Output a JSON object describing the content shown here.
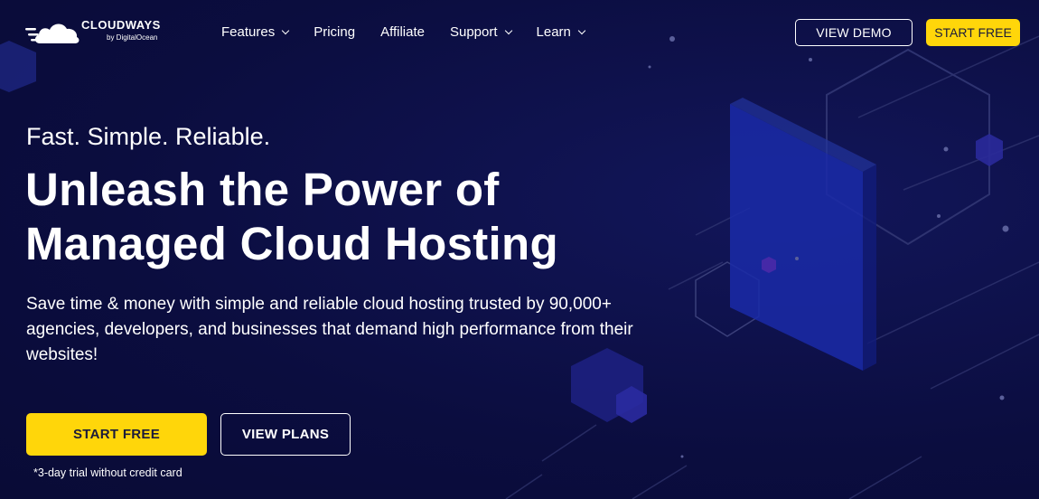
{
  "header": {
    "logo": {
      "name": "CLOUDWAYS",
      "sub": "by DigitalOcean",
      "icon": "cloud-logo-icon"
    },
    "nav": [
      {
        "label": "Features",
        "has_dropdown": true
      },
      {
        "label": "Pricing",
        "has_dropdown": false
      },
      {
        "label": "Affiliate",
        "has_dropdown": false
      },
      {
        "label": "Support",
        "has_dropdown": true
      },
      {
        "label": "Learn",
        "has_dropdown": true
      }
    ],
    "view_demo_label": "VIEW DEMO",
    "start_free_label": "START FREE"
  },
  "hero": {
    "eyebrow": "Fast. Simple. Reliable.",
    "headline_line1": "Unleash the Power of",
    "headline_line2": "Managed Cloud Hosting",
    "subtext": "Save time & money with simple and reliable cloud hosting trusted by 90,000+ agencies, developers, and businesses that demand high performance from their websites!",
    "start_free_label": "START FREE",
    "view_plans_label": "VIEW PLANS",
    "trial_note": "*3-day trial without credit card"
  },
  "colors": {
    "background": "#0b0d3f",
    "accent_yellow": "#ffd60a",
    "text": "#ffffff"
  }
}
